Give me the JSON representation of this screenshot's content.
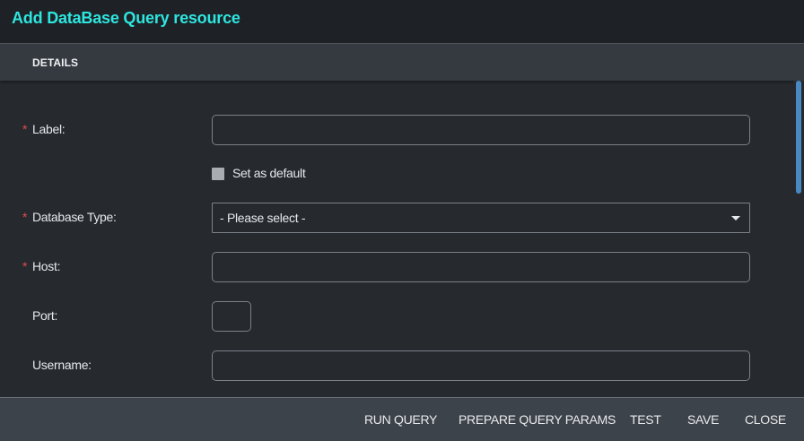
{
  "dialog": {
    "title": "Add DataBase Query resource"
  },
  "tabs": [
    {
      "label": "DETAILS"
    }
  ],
  "form": {
    "required_marker": "*",
    "label": {
      "label": "Label:",
      "value": ""
    },
    "set_default": {
      "label": "Set as default",
      "checked": false
    },
    "database_type": {
      "label": "Database Type:",
      "selected": "- Please select -"
    },
    "host": {
      "label": "Host:",
      "value": ""
    },
    "port": {
      "label": "Port:",
      "value": ""
    },
    "username": {
      "label": "Username:",
      "value": ""
    }
  },
  "footer": {
    "run_query": "RUN QUERY",
    "prepare_query_params": "PREPARE QUERY PARAMS",
    "test": "TEST",
    "save": "SAVE",
    "close": "CLOSE"
  },
  "colors": {
    "title": "#2ee6e0",
    "required": "#e24b4b",
    "scroll_thumb": "#4a88c0"
  }
}
